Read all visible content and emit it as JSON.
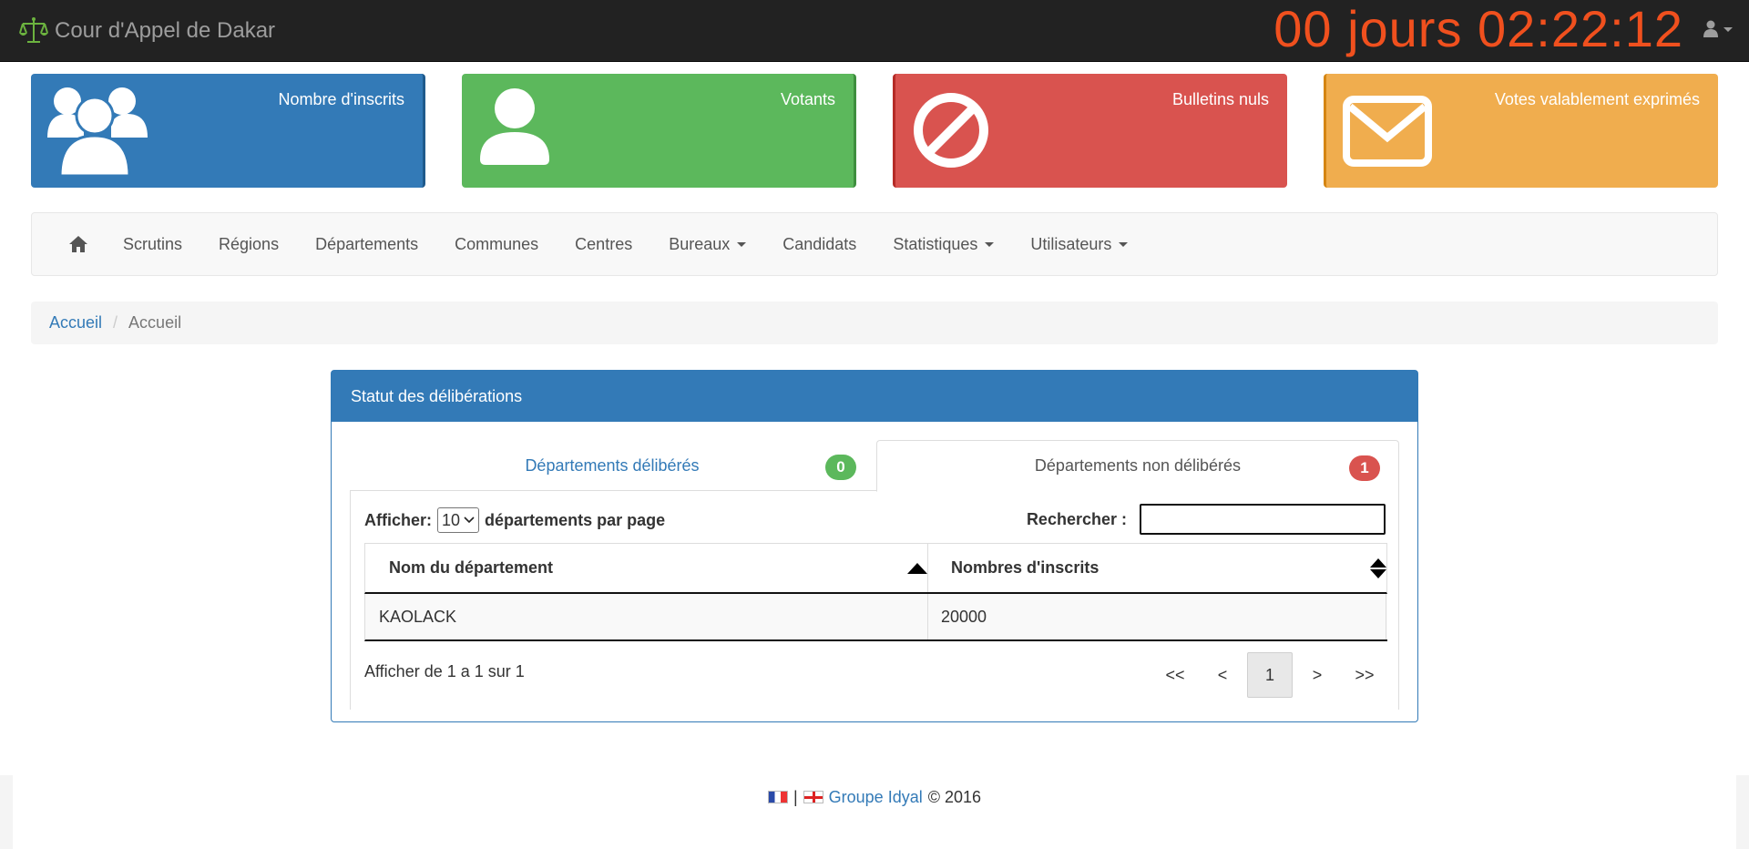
{
  "header": {
    "app_title": "Cour d'Appel de Dakar",
    "countdown": "00 jours 02:22:12",
    "timer_color": "#f0501e",
    "brand_icon": "scale-icon",
    "user_icon": "user-icon"
  },
  "tiles": [
    {
      "title": "Nombre d'inscrits",
      "icon": "users-icon",
      "color": "#337ab7"
    },
    {
      "title": "Votants",
      "icon": "user-icon",
      "color": "#5cb85c"
    },
    {
      "title": "Bulletins nuls",
      "icon": "ban-icon",
      "color": "#d9534f"
    },
    {
      "title": "Votes valablement exprimés",
      "icon": "envelope-icon",
      "color": "#f0ad4e"
    }
  ],
  "nav": {
    "home_icon": "home-icon",
    "items": [
      {
        "label": "Scrutins"
      },
      {
        "label": "Régions"
      },
      {
        "label": "Départements"
      },
      {
        "label": "Communes"
      },
      {
        "label": "Centres"
      },
      {
        "label": "Bureaux",
        "dropdown": true
      },
      {
        "label": "Candidats"
      },
      {
        "label": "Statistiques",
        "dropdown": true
      },
      {
        "label": "Utilisateurs",
        "dropdown": true
      }
    ]
  },
  "breadcrumb": {
    "link": "Accueil",
    "current": "Accueil"
  },
  "panel": {
    "title": "Statut des délibérations",
    "tabs": [
      {
        "label": "Départements délibérés",
        "count": "0",
        "active": false
      },
      {
        "label": "Départements non délibérés",
        "count": "1",
        "active": true
      }
    ],
    "length": {
      "prefix": "Afficher:",
      "selected": "10",
      "suffix": "départements par page"
    },
    "search": {
      "label": "Rechercher :",
      "value": ""
    },
    "table": {
      "columns": [
        "Nom du département",
        "Nombres d'inscrits"
      ],
      "rows": [
        [
          "KAOLACK",
          "20000"
        ]
      ]
    },
    "info": "Afficher de 1 a 1 sur 1",
    "pager": [
      "<<",
      "<",
      "1",
      ">",
      ">>"
    ],
    "current_page": "1"
  },
  "footer": {
    "sep": "|",
    "link": "Groupe Idyal",
    "copyright": "© 2016"
  }
}
